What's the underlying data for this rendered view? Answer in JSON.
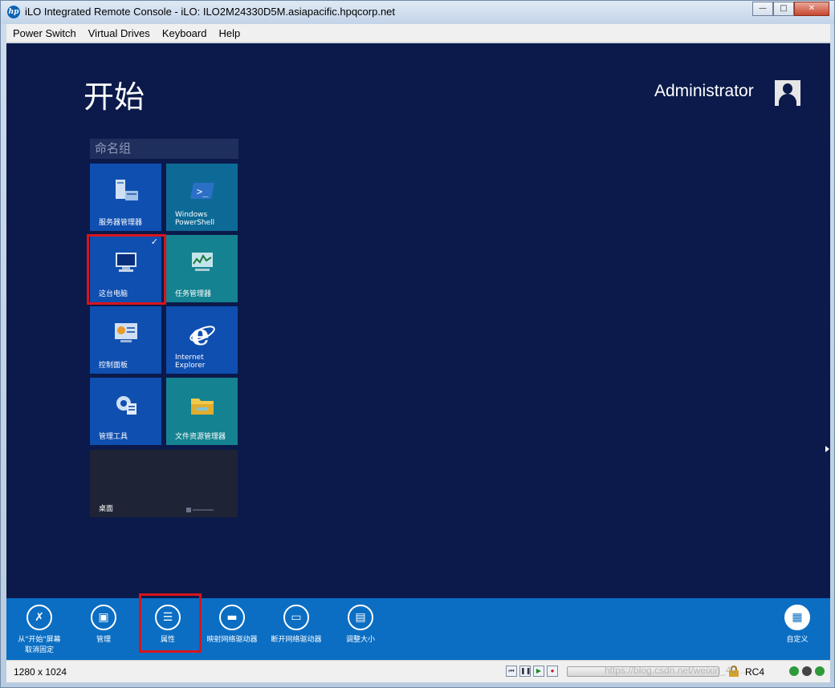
{
  "window": {
    "title": "iLO Integrated Remote Console - iLO: ILO2M24330D5M.asiapacific.hpqcorp.net",
    "logo_text": "hp"
  },
  "menu": {
    "items": [
      "Power Switch",
      "Virtual Drives",
      "Keyboard",
      "Help"
    ]
  },
  "start_screen": {
    "title": "开始",
    "user": "Administrator",
    "group_name": "命名组",
    "tiles": [
      {
        "label": "服务器管理器",
        "color": "#0f4fb0",
        "icon": "server-manager-icon"
      },
      {
        "label": "Windows PowerShell",
        "color": "#0d6a96",
        "icon": "powershell-icon"
      },
      {
        "label": "这台电脑",
        "color": "#0f4fb0",
        "icon": "computer-icon",
        "selected": true
      },
      {
        "label": "任务管理器",
        "color": "#148290",
        "icon": "task-manager-icon"
      },
      {
        "label": "控制面板",
        "color": "#0f4fb0",
        "icon": "control-panel-icon"
      },
      {
        "label": "Internet Explorer",
        "color": "#0f4fb0",
        "icon": "ie-icon"
      },
      {
        "label": "管理工具",
        "color": "#0f4fb0",
        "icon": "admin-tools-icon"
      },
      {
        "label": "文件资源管理器",
        "color": "#148290",
        "icon": "file-explorer-icon"
      },
      {
        "label": "桌面",
        "color": "#1e2436",
        "icon": "desktop-icon"
      }
    ]
  },
  "app_bar": {
    "buttons": [
      {
        "label": "从\"开始\"屏幕取消固定",
        "icon": "unpin-icon"
      },
      {
        "label": "管理",
        "icon": "manage-icon"
      },
      {
        "label": "属性",
        "icon": "properties-icon",
        "highlighted": true
      },
      {
        "label": "映射网络驱动器",
        "icon": "map-drive-icon"
      },
      {
        "label": "断开网络驱动器",
        "icon": "disconnect-drive-icon"
      },
      {
        "label": "调整大小",
        "icon": "resize-icon"
      },
      {
        "label": "自定义",
        "icon": "customize-icon"
      }
    ]
  },
  "status": {
    "resolution": "1280 x 1024",
    "encryption": "RC4",
    "watermark": "https://blog.csdn.net/weixin_40…"
  },
  "colors": {
    "screen_bg": "#0b1a4a",
    "appbar_bg": "#0b6ec3",
    "highlight": "#d9141b"
  }
}
